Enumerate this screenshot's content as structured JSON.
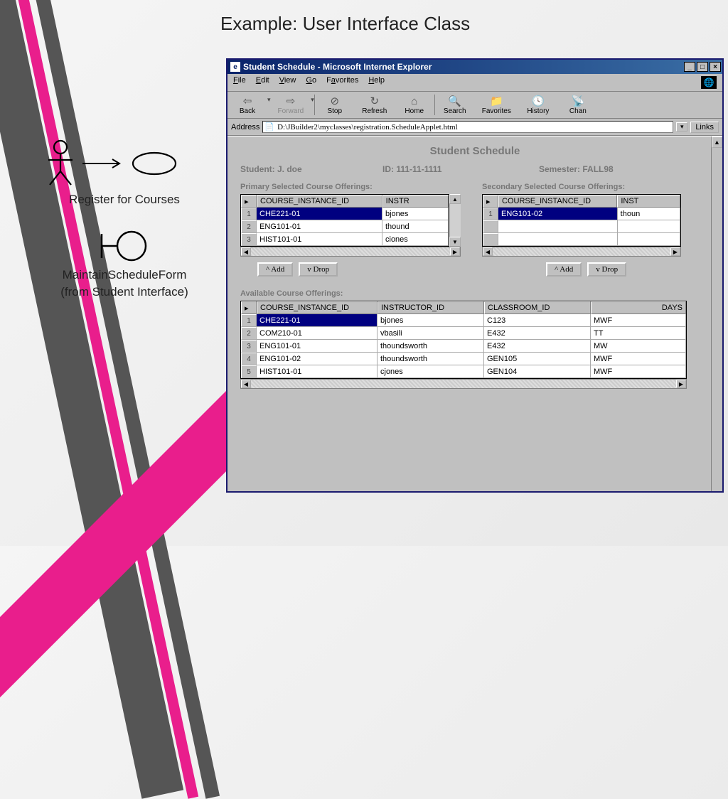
{
  "slide_title": "Example: User Interface Class",
  "uml": {
    "use_case_label": "Register for Courses",
    "boundary_label_line1": "MaintainScheduleForm",
    "boundary_label_line2": "(from Student Interface)"
  },
  "window": {
    "title": "Student Schedule - Microsoft Internet Explorer",
    "menus": {
      "file": "File",
      "edit": "Edit",
      "view": "View",
      "go": "Go",
      "favorites": "Favorites",
      "help": "Help"
    },
    "toolbar": {
      "back": "Back",
      "forward": "Forward",
      "stop": "Stop",
      "refresh": "Refresh",
      "home": "Home",
      "search": "Search",
      "favorites": "Favorites",
      "history": "History",
      "channels": "Chan"
    },
    "address_label": "Address",
    "address_value": "D:\\JBuilder2\\myclasses\\registration.ScheduleApplet.html",
    "links_label": "Links"
  },
  "schedule": {
    "title": "Student Schedule",
    "student_label": "Student: J. doe",
    "id_label": "ID: 111-11-1111",
    "semester_label": "Semester: FALL98",
    "primary_label": "Primary Selected Course Offerings:",
    "secondary_label": "Secondary Selected Course Offerings:",
    "available_label": "Available Course Offerings:",
    "add_button": "^ Add",
    "drop_button": "v Drop",
    "columns_short": {
      "course": "COURSE_INSTANCE_ID",
      "instr": "INSTR"
    },
    "columns_short2": {
      "course": "COURSE_INSTANCE_ID",
      "instr": "INST"
    },
    "columns_full": {
      "course": "COURSE_INSTANCE_ID",
      "instructor": "INSTRUCTOR_ID",
      "classroom": "CLASSROOM_ID",
      "days": "DAYS"
    },
    "primary_rows": [
      {
        "n": "1",
        "course": "CHE221-01",
        "instr": "bjones"
      },
      {
        "n": "2",
        "course": "ENG101-01",
        "instr": "thound"
      },
      {
        "n": "3",
        "course": "HIST101-01",
        "instr": "ciones"
      }
    ],
    "secondary_rows": [
      {
        "n": "1",
        "course": "ENG101-02",
        "instr": "thoun"
      }
    ],
    "available_rows": [
      {
        "n": "1",
        "course": "CHE221-01",
        "instructor": "bjones",
        "classroom": "C123",
        "days": "MWF"
      },
      {
        "n": "2",
        "course": "COM210-01",
        "instructor": "vbasili",
        "classroom": "E432",
        "days": "TT"
      },
      {
        "n": "3",
        "course": "ENG101-01",
        "instructor": "thoundsworth",
        "classroom": "E432",
        "days": "MW"
      },
      {
        "n": "4",
        "course": "ENG101-02",
        "instructor": "thoundsworth",
        "classroom": "GEN105",
        "days": "MWF"
      },
      {
        "n": "5",
        "course": "HIST101-01",
        "instructor": "cjones",
        "classroom": "GEN104",
        "days": "MWF"
      }
    ]
  }
}
